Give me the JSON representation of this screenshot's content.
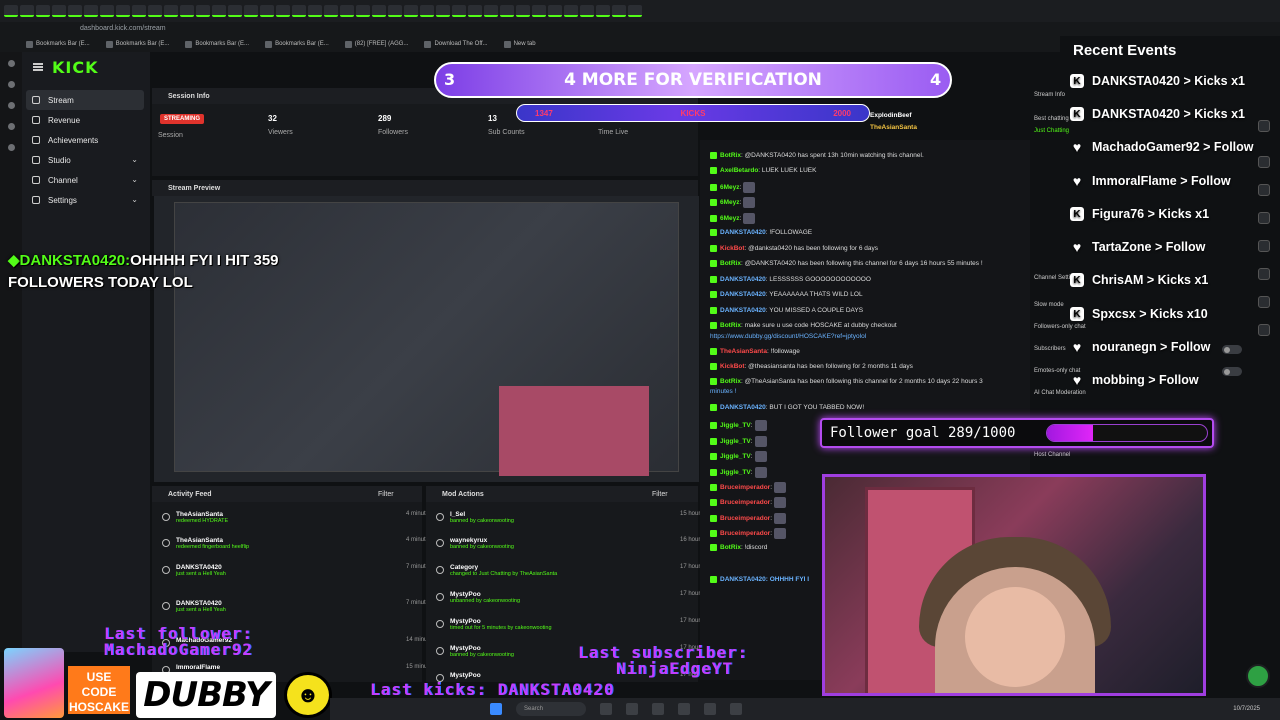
{
  "browser": {
    "url": "dashboard.kick.com/stream",
    "bookmarks": [
      "Bookmarks Bar (E...",
      "Bookmarks Bar (E...",
      "Bookmarks Bar (E...",
      "Bookmarks Bar (E...",
      "(82) [FREE] (AGG...",
      "Download The Off...",
      "New tab"
    ]
  },
  "sidebar": {
    "logo": "KICK",
    "items": [
      {
        "label": "Stream",
        "active": true
      },
      {
        "label": "Revenue"
      },
      {
        "label": "Achievements"
      },
      {
        "label": "Studio",
        "chevron": "⌄"
      },
      {
        "label": "Channel",
        "chevron": "⌄"
      },
      {
        "label": "Settings",
        "chevron": "⌄"
      }
    ]
  },
  "session": {
    "header": "Session Info",
    "badge": "STREAMING",
    "session_label": "Session",
    "viewers": {
      "value": "32",
      "label": "Viewers"
    },
    "followers": {
      "value": "289",
      "label": "Followers"
    },
    "subs": {
      "value": "13",
      "label": "Sub Counts"
    },
    "time_live": {
      "label": "Time Live"
    }
  },
  "preview": {
    "header": "Stream Preview"
  },
  "activity": {
    "header": "Activity Feed",
    "filter": "Filter",
    "items": [
      {
        "user": "TheAsianSanta",
        "desc": "redeemed HYDRATE",
        "time": "4 minutes ago"
      },
      {
        "user": "TheAsianSanta",
        "desc": "redeemed fingerboard heelflip",
        "time": "4 minutes ago"
      },
      {
        "user": "DANKSTA0420",
        "desc": "just sent a Hell Yeah",
        "time": "7 minutes ago"
      },
      {
        "user": "DANKSTA0420",
        "desc": "just sent a Hell Yeah",
        "time": "7 minutes ago"
      },
      {
        "user": "MachadoGamer92",
        "desc": "",
        "time": "14 minutes ago"
      },
      {
        "user": "ImmoralFlame",
        "desc": "",
        "time": "15 minutes ago"
      }
    ]
  },
  "mod": {
    "header": "Mod Actions",
    "filter": "Filter",
    "items": [
      {
        "user": "l_Sel",
        "desc": "banned by cakeonwooting",
        "time": "15 hours ago"
      },
      {
        "user": "waynekyrux",
        "desc": "banned by cakeonwooting",
        "time": "16 hours ago"
      },
      {
        "user": "Category",
        "desc": "changed to Just Chatting by TheAsianSanta",
        "time": "17 hours ago"
      },
      {
        "user": "MystyPoo",
        "desc": "unbanned by cakeonwooting",
        "time": "17 hours ago"
      },
      {
        "user": "MystyPoo",
        "desc": "timed out for 5 minutes by cakeonwooting",
        "time": "17 hours ago"
      },
      {
        "user": "MystyPoo",
        "desc": "banned by cakeonwooting",
        "time": "17 hours ago"
      },
      {
        "user": "MystyPoo",
        "desc": "",
        "time": "17 hours ago"
      }
    ]
  },
  "chat": {
    "pinned": [
      "ExplodinBeef",
      "TheAsianSanta"
    ],
    "lines": [
      {
        "name": "BotRix",
        "color": "green",
        "msg": ": @DANKSTA0420 has spent 13h 10min watching this channel."
      },
      {
        "name": "AxelBetardo",
        "color": "green",
        "msg": ": LUEK LUEK LUEK"
      },
      {
        "name": "6Meyz",
        "color": "green",
        "msg": ":"
      },
      {
        "name": "6Meyz",
        "color": "green",
        "msg": ":"
      },
      {
        "name": "6Meyz",
        "color": "green",
        "msg": ":"
      },
      {
        "name": "DANKSTA0420",
        "color": "blue",
        "msg": ": !FOLLOWAGE"
      },
      {
        "name": "KickBot",
        "color": "red",
        "msg": ": @danksta0420 has been following for 6 days"
      },
      {
        "name": "BotRix",
        "color": "green",
        "msg": ": @DANKSTA0420 has been following this channel for 6 days 16 hours 55 minutes !"
      },
      {
        "name": "DANKSTA0420",
        "color": "blue",
        "msg": ": LESSSSSS GOOOOOOOOOOOO"
      },
      {
        "name": "DANKSTA0420",
        "color": "blue",
        "msg": ": YEAAAAAAA THATS WILD LOL"
      },
      {
        "name": "DANKSTA0420",
        "color": "blue",
        "msg": ": YOU MISSED A COUPLE DAYS"
      },
      {
        "name": "BotRix",
        "color": "green",
        "msg": ": make sure u use code HOSCAKE at dubby checkout"
      },
      {
        "name": "",
        "color": "green",
        "msg": "https://www.dubby.gg/discount/HOSCAKE?ref=jptyolol"
      },
      {
        "name": "TheAsianSanta",
        "color": "red",
        "msg": ": !followage"
      },
      {
        "name": "KickBot",
        "color": "red",
        "msg": ": @theasiansanta has been following for 2 months 11 days"
      },
      {
        "name": "BotRix",
        "color": "green",
        "msg": ": @TheAsianSanta has been following this channel for 2 months 10 days 22 hours 3"
      },
      {
        "name": "",
        "color": "green",
        "msg": "minutes !"
      },
      {
        "name": "DANKSTA0420",
        "color": "blue",
        "msg": ": BUT I GOT YOU TABBED NOW!"
      },
      {
        "name": "Jiggle_TV",
        "color": "green",
        "msg": ":"
      },
      {
        "name": "Jiggle_TV",
        "color": "green",
        "msg": ":"
      },
      {
        "name": "Jiggle_TV",
        "color": "green",
        "msg": ":"
      },
      {
        "name": "Jiggle_TV",
        "color": "green",
        "msg": ":"
      },
      {
        "name": "Bruceimperador",
        "color": "red",
        "msg": ":"
      },
      {
        "name": "Bruceimperador",
        "color": "red",
        "msg": ":"
      },
      {
        "name": "Bruceimperador",
        "color": "red",
        "msg": ":"
      },
      {
        "name": "Bruceimperador",
        "color": "red",
        "msg": ":"
      },
      {
        "name": "BotRix",
        "color": "green",
        "msg": ": !discord"
      }
    ],
    "input_preview": "DANKSTA0420: OHHHH FYI I"
  },
  "overlay": {
    "verification": {
      "left": "3",
      "text": "4 MORE FOR VERIFICATION",
      "right": "4"
    },
    "kicks_bar": {
      "start": "1347",
      "mid": "KICKS",
      "end": "2000"
    },
    "recent_title": "Recent Events",
    "events": [
      {
        "icon": "kick",
        "text": "DANKSTA0420 > Kicks x1"
      },
      {
        "icon": "kick",
        "text": "DANKSTA0420 > Kicks x1"
      },
      {
        "icon": "heart",
        "text": "MachadoGamer92 > Follow"
      },
      {
        "icon": "heart",
        "text": "ImmoralFlame > Follow"
      },
      {
        "icon": "kick",
        "text": "Figura76 > Kicks x1"
      },
      {
        "icon": "heart",
        "text": "TartaZone > Follow"
      },
      {
        "icon": "kick",
        "text": "ChrisAM > Kicks x1"
      },
      {
        "icon": "kick",
        "text": "Spxcsx > Kicks x10"
      },
      {
        "icon": "heart",
        "text": "nouranegn > Follow"
      },
      {
        "icon": "heart",
        "text": "mobbing > Follow"
      }
    ],
    "follower_goal": {
      "label": "Follower goal 289/1000",
      "progress": 0.289
    },
    "ticker_name": "DANKSTA0420:",
    "ticker_line1": "OHHHH FYI I HIT 359",
    "ticker_line2": "FOLLOWERS TODAY LOL",
    "last_follower": "Last follower:",
    "last_follower_name": "MachadoGamer92",
    "last_subscriber": "Last subscriber:",
    "last_subscriber_name": "NinjaEdgeYT",
    "last_kicks": "Last kicks: DANKSTA0420",
    "sponsor_code": "USE CODE HOSCAKE",
    "sponsor_brand": "DUBBY"
  },
  "side_settings": {
    "stream_info": "Stream Info",
    "best_chatting": "Best chatting",
    "just_chatting": "Just Chatting",
    "slow_mode": "Slow mode",
    "followers_only": "Followers-only chat",
    "subscribers": "Subscribers",
    "emotes_only": "Emotes-only chat",
    "ai_moderation": "AI Chat Moderation",
    "host_channel": "Host Channel",
    "channel_settings": "Channel Settings"
  },
  "taskbar": {
    "search": "Search",
    "date": "10/7/2025"
  },
  "colors": {
    "kick_green": "#53fc18",
    "accent_purple": "#b44cf0",
    "streaming_red": "#e0332c"
  }
}
